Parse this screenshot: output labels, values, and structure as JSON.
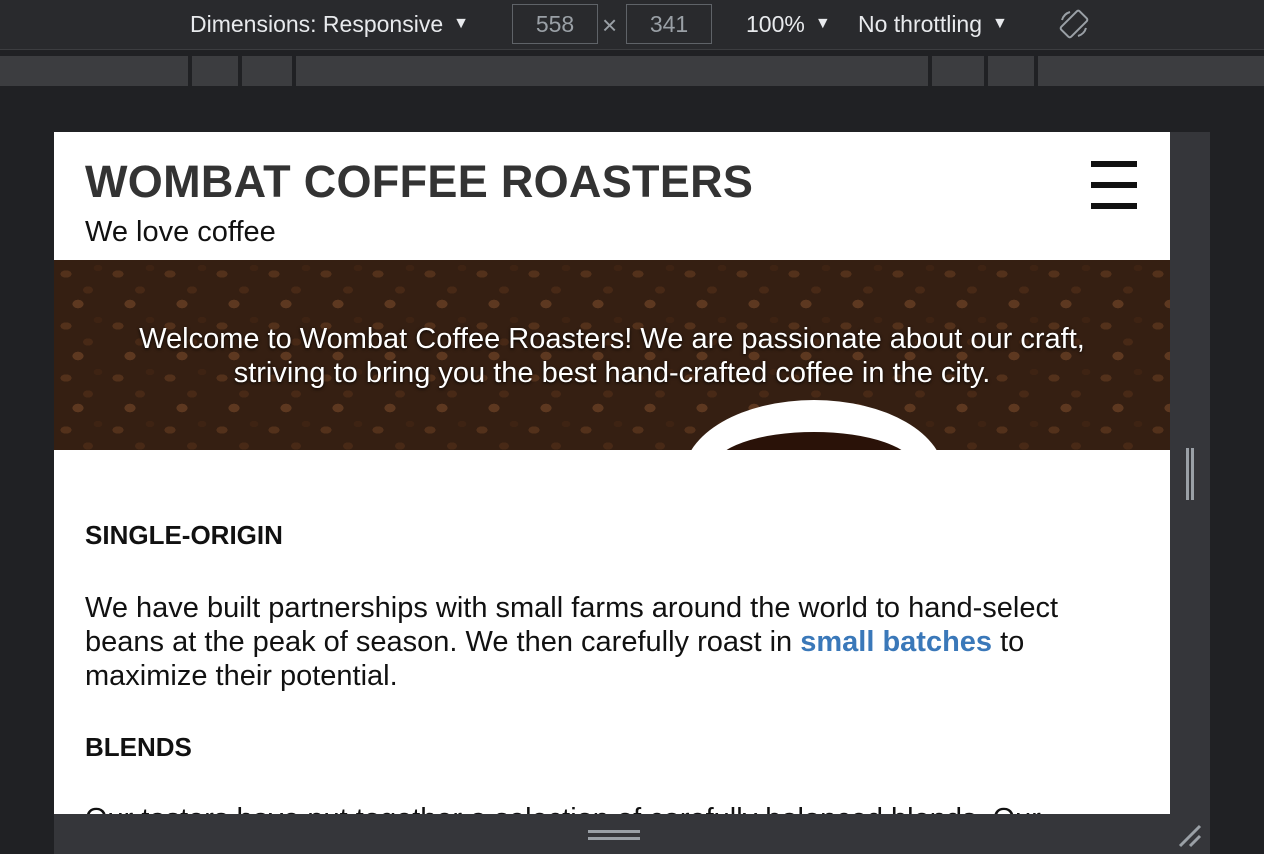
{
  "devtools": {
    "dimensions_label": "Dimensions: Responsive",
    "width": "558",
    "height": "341",
    "times": "×",
    "zoom": "100%",
    "throttling": "No throttling",
    "caret": "▼",
    "icons": {
      "rotate": "rotate-icon",
      "resize_vertical": "drag-grip-icon",
      "resize_horizontal": "drag-grip-icon",
      "resize_corner": "resize-corner-icon"
    }
  },
  "site": {
    "title": "WOMBAT COFFEE ROASTERS",
    "tagline": "We love coffee",
    "menu_icon": "hamburger-menu-icon",
    "hero_text": "Welcome to Wombat Coffee Roasters! We are passionate about our craft, striving to bring you the best hand-crafted coffee in the city.",
    "sections": {
      "single_origin": {
        "heading": "SINGLE-ORIGIN",
        "text_before": "We have built partnerships with small farms around the world to hand-select beans at the peak of season. We then carefully roast in ",
        "link": "small batches",
        "text_after": " to maximize their potential."
      },
      "blends": {
        "heading": "BLENDS",
        "text": "Our tasters have put together a selection of carefully balanced blends. Our"
      }
    },
    "colors": {
      "link": "#3a78b9",
      "title": "#333333"
    }
  }
}
